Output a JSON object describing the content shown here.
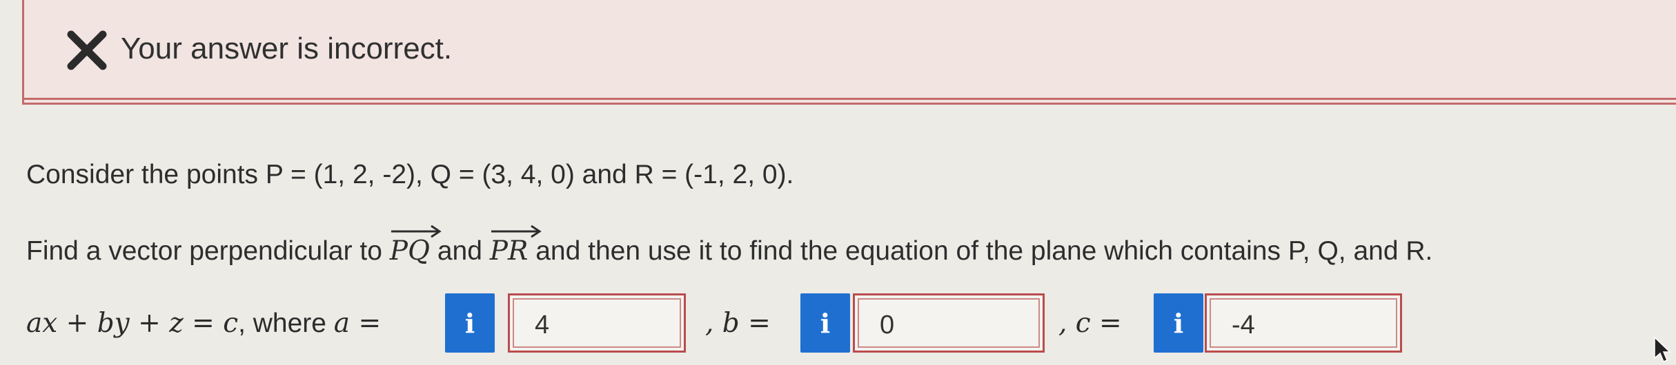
{
  "banner": {
    "message": "Your answer is incorrect.",
    "status_color": "#c46a6a",
    "icon": "x-icon"
  },
  "problem": {
    "line1": "Consider the points P = (1, 2, -2), Q = (3, 4, 0) and R = (-1, 2, 0).",
    "line2_part1": "Find a vector perpendicular to ",
    "vec1": "PQ",
    "line2_part2": " and ",
    "vec2": "PR",
    "line2_part3": " and then use it to find the equation of the plane which contains P, Q, and R."
  },
  "equation": {
    "prefix_math": "ax + by + z = c",
    "prefix_text": ", where ",
    "a_label": "a =",
    "b_label": ", b =",
    "c_label": ", c ="
  },
  "fields": {
    "a_value": "4",
    "b_value": "0",
    "c_value": "-4",
    "info_glyph": "i"
  },
  "accent_color": "#1f6fd1"
}
